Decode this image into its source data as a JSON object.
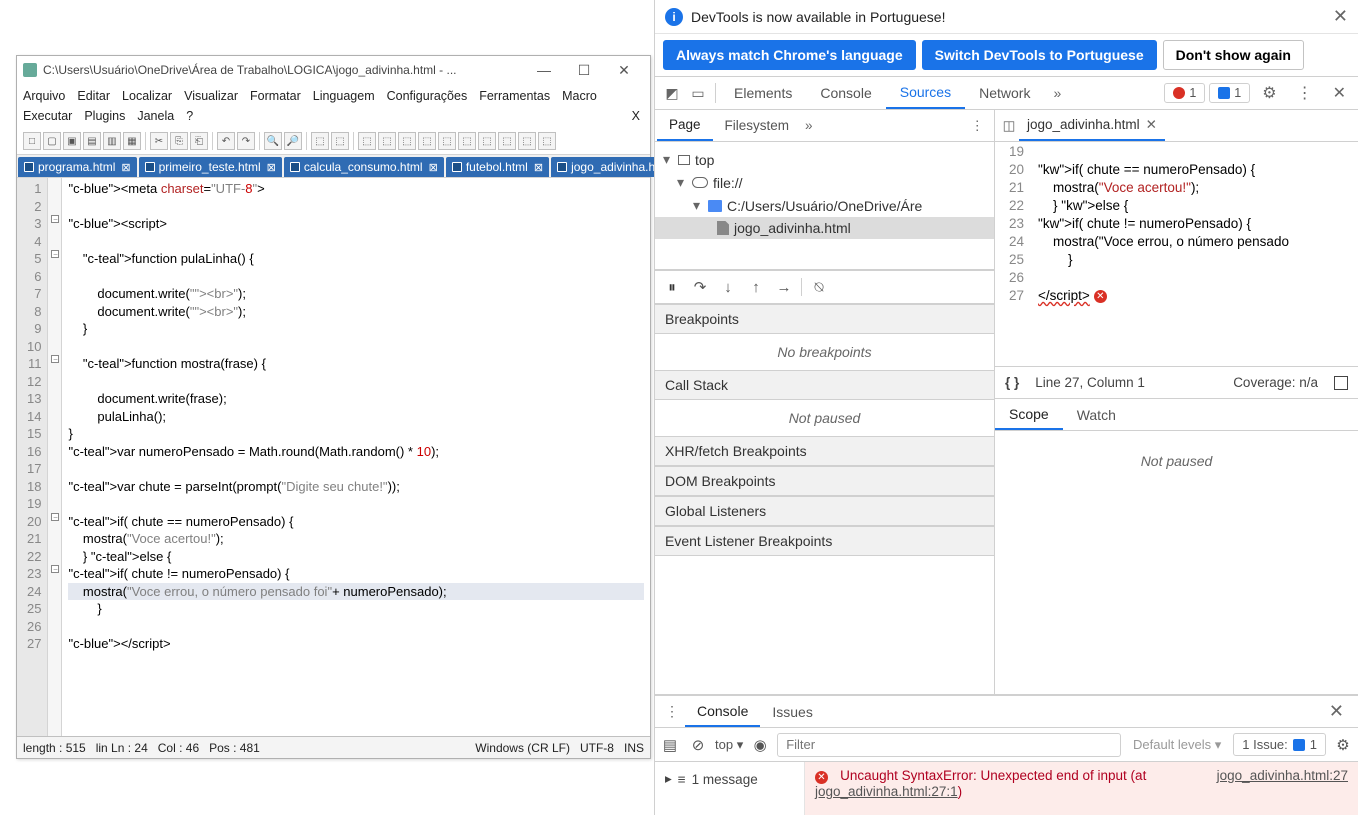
{
  "npp": {
    "title": "C:\\Users\\Usuário\\OneDrive\\Área de Trabalho\\LOGICA\\jogo_adivinha.html - ...",
    "winbtns": {
      "min": "—",
      "max": "☐",
      "close": "✕"
    },
    "menu": [
      "Arquivo",
      "Editar",
      "Localizar",
      "Visualizar",
      "Formatar",
      "Linguagem",
      "Configurações",
      "Ferramentas",
      "Macro",
      "Executar",
      "Plugins",
      "Janela",
      "?"
    ],
    "tabs": [
      "programa.html",
      "primeiro_teste.html",
      "calcula_consumo.html",
      "futebol.html",
      "jogo_adivinha.html"
    ],
    "code_lines": [
      "<meta charset=\"UTF-8\">",
      "",
      "<script>",
      "",
      "    function pulaLinha() {",
      "",
      "        document.write(\"<br>\");",
      "        document.write(\"<br>\");",
      "    }",
      "",
      "    function mostra(frase) {",
      "",
      "        document.write(frase);",
      "        pulaLinha();",
      "}",
      "var numeroPensado = Math.round(Math.random() * 10);",
      "",
      "var chute = parseInt(prompt(\"Digite seu chute!\"));",
      "",
      "if( chute == numeroPensado) {",
      "    mostra(\"Voce acertou!\");",
      "    } else {",
      "if( chute != numeroPensado) {",
      "    mostra(\"Voce errou, o número pensado foi\"+ numeroPensado);",
      "        }",
      "",
      "</script>"
    ],
    "status": {
      "length": "length : 515",
      "lines": "lin Ln : 24",
      "col": "Col : 46",
      "pos": "Pos : 481",
      "eol": "Windows (CR LF)",
      "enc": "UTF-8",
      "mode": "INS"
    }
  },
  "devtools": {
    "info": "DevTools is now available in Portuguese!",
    "btn_always": "Always match Chrome's language",
    "btn_switch": "Switch DevTools to Portuguese",
    "btn_dont": "Don't show again",
    "tabs": [
      "Elements",
      "Console",
      "Sources",
      "Network"
    ],
    "active_tab": "Sources",
    "errors": "1",
    "messages": "1",
    "subtabs": [
      "Page",
      "Filesystem"
    ],
    "tree": {
      "top": "top",
      "file": "file://",
      "path": "C:/Users/Usuário/OneDrive/Áre",
      "leaf": "jogo_adivinha.html"
    },
    "source_tab": "jogo_adivinha.html",
    "src_start": 19,
    "src_lines": [
      "",
      "if( chute == numeroPensado) {",
      "    mostra(\"Voce acertou!\");",
      "    } else {",
      "if( chute != numeroPensado) {",
      "    mostra(\"Voce errou, o número pensado",
      "        }",
      "",
      "</script>"
    ],
    "cursor": "Line 27, Column 1",
    "coverage": "Coverage: n/a",
    "panels": {
      "breakpoints": "Breakpoints",
      "no_bp": "No breakpoints",
      "callstack": "Call Stack",
      "not_paused": "Not paused",
      "xhr": "XHR/fetch Breakpoints",
      "dom": "DOM Breakpoints",
      "gl": "Global Listeners",
      "elb": "Event Listener Breakpoints"
    },
    "scope": {
      "tabs": [
        "Scope",
        "Watch"
      ],
      "msg": "Not paused"
    },
    "drawer": {
      "tabs": [
        "Console",
        "Issues"
      ],
      "ctx": "top",
      "filter_ph": "Filter",
      "levels": "Default levels",
      "issue": "1 Issue:",
      "issue_n": "1",
      "left_msg": "1 message",
      "err_text": "Uncaught SyntaxError: Unexpected end of input (at ",
      "err_link": "jogo_adivinha.html:27",
      "err_loc": "jogo_adivinha.html:27:1",
      "err_close": ")"
    }
  }
}
